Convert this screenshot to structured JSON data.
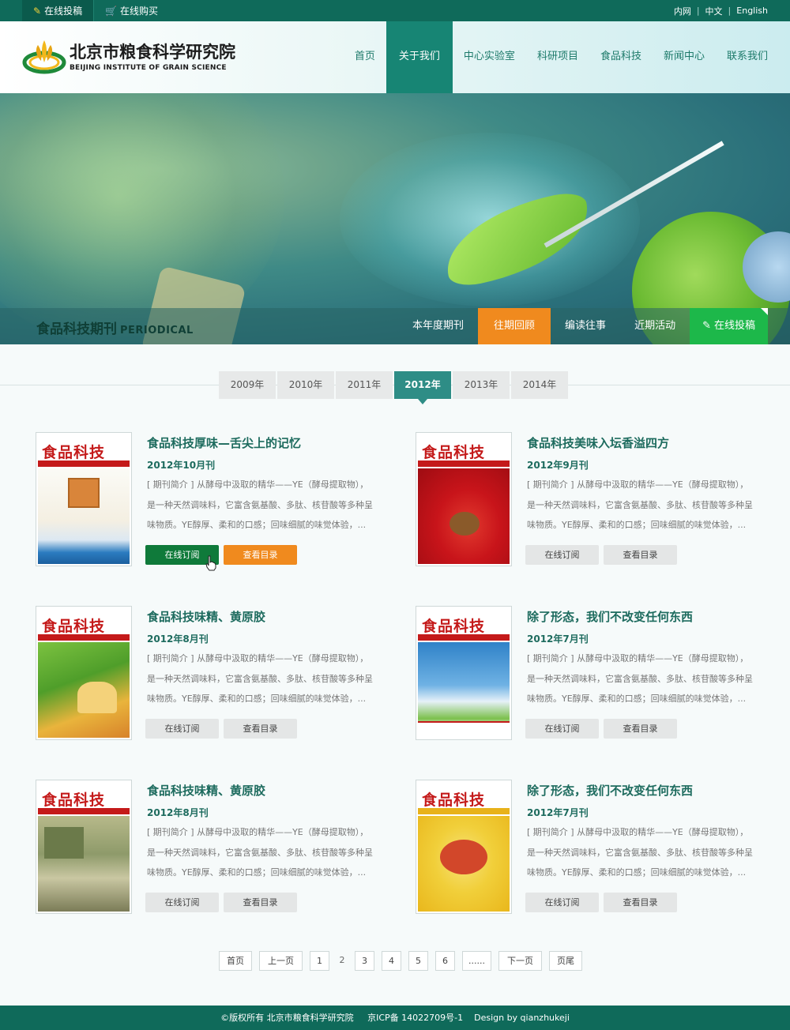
{
  "topbar": {
    "submit_link": "在线投稿",
    "buy_link": "在线购买",
    "intranet": "内网",
    "chinese": "中文",
    "english": "English"
  },
  "logo": {
    "name_cn": "北京市粮食科学研究院",
    "name_en": "BEIJING INSTITUTE OF GRAIN SCIENCE"
  },
  "nav": [
    "首页",
    "关于我们",
    "中心实验室",
    "科研项目",
    "食品科技",
    "新闻中心",
    "联系我们"
  ],
  "nav_active": "关于我们",
  "banner": {
    "title": "食品科技期刊",
    "title_en": "PERIODICAL"
  },
  "subnav": [
    "本年度期刊",
    "往期回顾",
    "编读往事",
    "近期活动",
    "在线投稿"
  ],
  "subnav_active": "往期回顾",
  "years": [
    "2009年",
    "2010年",
    "2011年",
    "2012年",
    "2013年",
    "2014年"
  ],
  "year_active": "2012年",
  "cover_masthead": "食品科技",
  "issues": [
    {
      "title": "食品科技厚味—舌尖上的记忆",
      "date": "2012年10月刊",
      "desc": "[ 期刊简介 ] 从酵母中汲取的精华——YE（酵母提取物），是一种天然调味料，它富含氨基酸、多肽、核苷酸等多种呈味物质。YE醇厚、柔和的口感；回味细腻的味觉体验，...",
      "btn_subscribe": "在线订阅",
      "btn_toc": "查看目录"
    },
    {
      "title": "食品科技美味入坛香溢四方",
      "date": "2012年9月刊",
      "desc": "[ 期刊简介 ] 从酵母中汲取的精华——YE（酵母提取物），是一种天然调味料，它富含氨基酸、多肽、核苷酸等多种呈味物质。YE醇厚、柔和的口感；回味细腻的味觉体验，...",
      "btn_subscribe": "在线订阅",
      "btn_toc": "查看目录"
    },
    {
      "title": "食品科技味精、黄原胶",
      "date": "2012年8月刊",
      "desc": "[ 期刊简介 ] 从酵母中汲取的精华——YE（酵母提取物），是一种天然调味料，它富含氨基酸、多肽、核苷酸等多种呈味物质。YE醇厚、柔和的口感；回味细腻的味觉体验，...",
      "btn_subscribe": "在线订阅",
      "btn_toc": "查看目录"
    },
    {
      "title": "除了形态，我们不改变任何东西",
      "date": "2012年7月刊",
      "desc": "[ 期刊简介 ] 从酵母中汲取的精华——YE（酵母提取物），是一种天然调味料，它富含氨基酸、多肽、核苷酸等多种呈味物质。YE醇厚、柔和的口感；回味细腻的味觉体验，...",
      "btn_subscribe": "在线订阅",
      "btn_toc": "查看目录"
    },
    {
      "title": "食品科技味精、黄原胶",
      "date": "2012年8月刊",
      "desc": "[ 期刊简介 ] 从酵母中汲取的精华——YE（酵母提取物），是一种天然调味料，它富含氨基酸、多肽、核苷酸等多种呈味物质。YE醇厚、柔和的口感；回味细腻的味觉体验，...",
      "btn_subscribe": "在线订阅",
      "btn_toc": "查看目录"
    },
    {
      "title": "除了形态，我们不改变任何东西",
      "date": "2012年7月刊",
      "desc": "[ 期刊简介 ] 从酵母中汲取的精华——YE（酵母提取物），是一种天然调味料，它富含氨基酸、多肽、核苷酸等多种呈味物质。YE醇厚、柔和的口感；回味细腻的味觉体验，...",
      "btn_subscribe": "在线订阅",
      "btn_toc": "查看目录"
    }
  ],
  "pager": {
    "first": "首页",
    "prev": "上一页",
    "pages": [
      "1",
      "2",
      "3",
      "4",
      "5",
      "6",
      "......"
    ],
    "current": "2",
    "next": "下一页",
    "last": "页尾"
  },
  "footer": {
    "copyright": "©版权所有  北京市粮食科学研究院",
    "icp": "京ICP备 14022709号-1",
    "design": "Design by qianzhukeji"
  },
  "colors": {
    "brand_green": "#0f6a5a",
    "nav_active": "#178574",
    "accent_orange": "#f08a1e",
    "submit_green": "#1db84a",
    "title_green": "#1d6b5e"
  }
}
